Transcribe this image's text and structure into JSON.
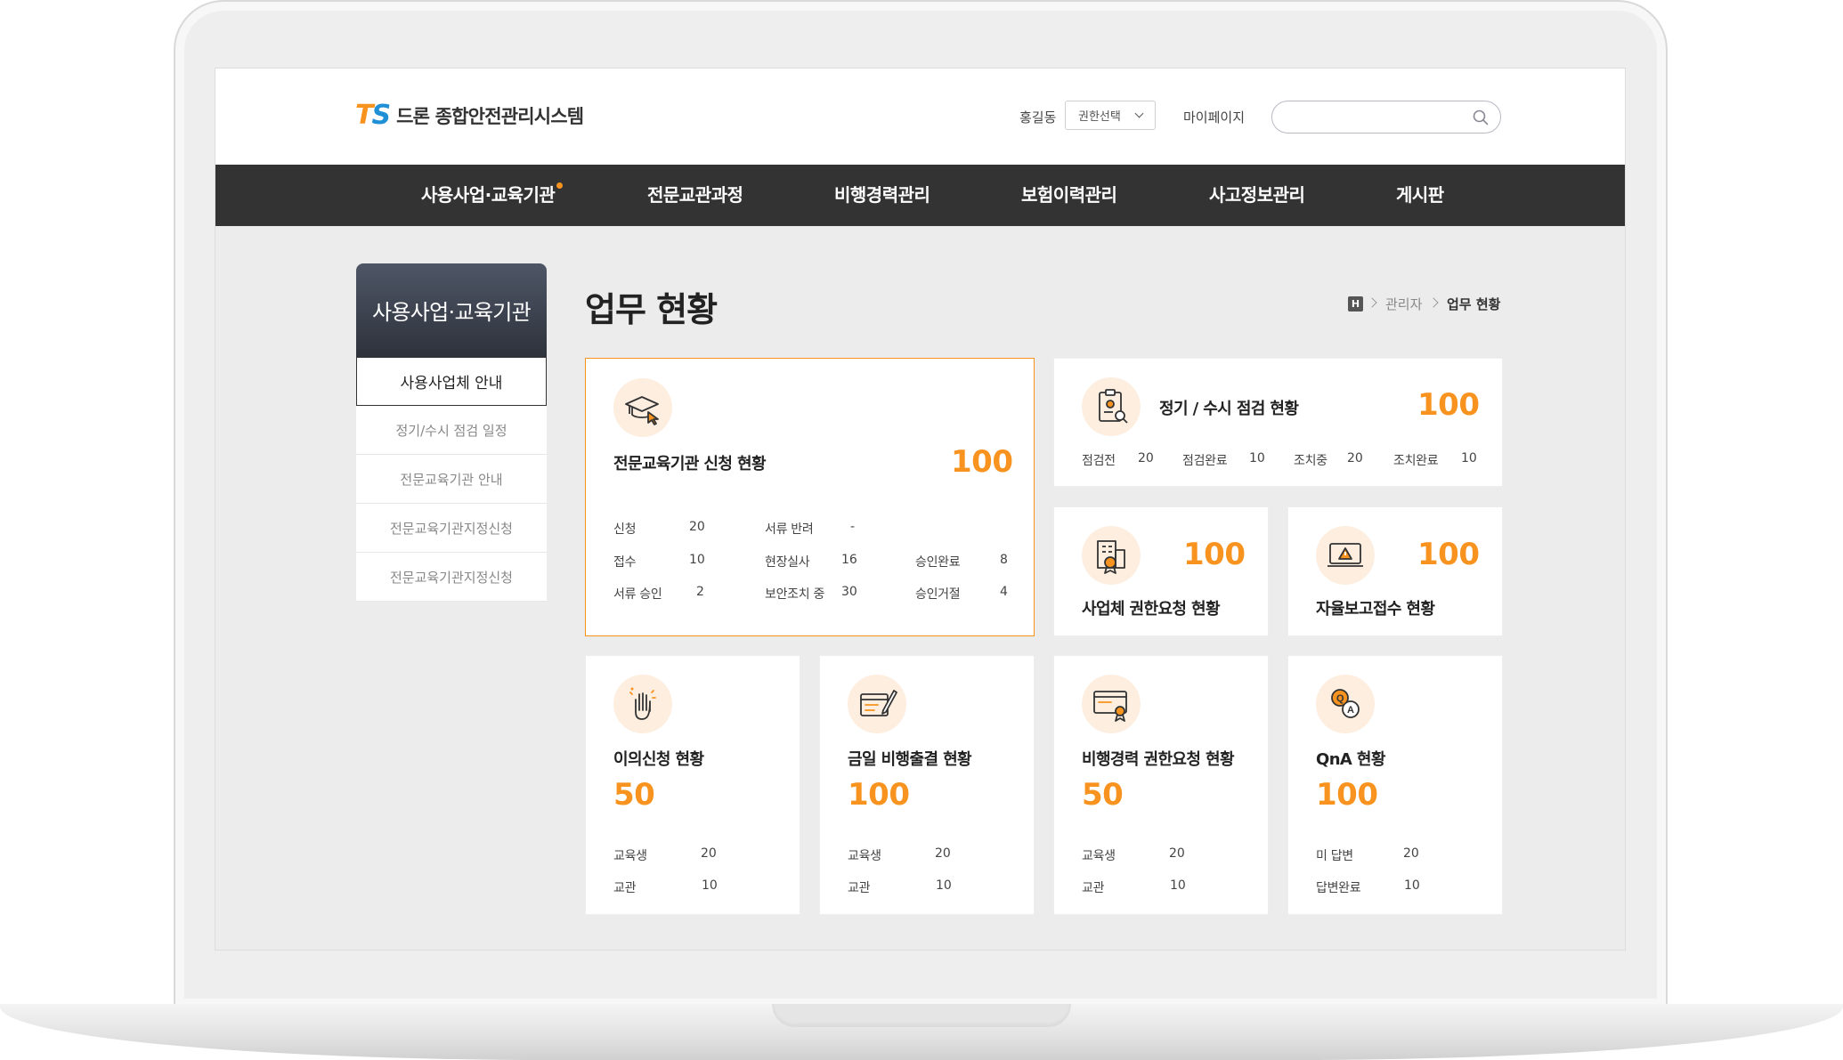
{
  "header": {
    "logo_mark_t": "T",
    "logo_mark_s": "S",
    "logo_text": "드론 종합안전관리시스템",
    "user_name": "홍길동",
    "role_select": "권한선택",
    "mypage": "마이페이지",
    "search_value": ""
  },
  "gnb": {
    "items": [
      {
        "label": "사용사업·교육기관"
      },
      {
        "label": "전문교관과정"
      },
      {
        "label": "비행경력관리"
      },
      {
        "label": "보험이력관리"
      },
      {
        "label": "사고정보관리"
      },
      {
        "label": "게시판"
      }
    ]
  },
  "lnb": {
    "title": "사용사업·교육기관",
    "items": [
      {
        "label": "사용사업체 안내"
      },
      {
        "label": "정기/수시 점검 일정"
      },
      {
        "label": "전문교육기관 안내"
      },
      {
        "label": "전문교육기관지정신청"
      },
      {
        "label": "전문교육기관지정신청"
      }
    ]
  },
  "page": {
    "title": "업무 현황",
    "breadcrumb": {
      "home": "H",
      "parent": "관리자",
      "current": "업무 현황"
    }
  },
  "cards": {
    "edu_apply": {
      "title": "전문교육기관 신청 현황",
      "count": "100",
      "stats": [
        {
          "label": "신청",
          "value": "20"
        },
        {
          "label": "서류 반려",
          "value": "-"
        },
        {
          "label": "접수",
          "value": "10"
        },
        {
          "label": "현장실사",
          "value": "16"
        },
        {
          "label": "승인완료",
          "value": "8"
        },
        {
          "label": "서류 승인",
          "value": "2"
        },
        {
          "label": "보안조치 중",
          "value": "30"
        },
        {
          "label": "승인거절",
          "value": "4"
        }
      ]
    },
    "inspection": {
      "title": "정기 / 수시 점검 현황",
      "count": "100",
      "stats": [
        {
          "label": "점검전",
          "value": "20"
        },
        {
          "label": "점검완료",
          "value": "10"
        },
        {
          "label": "조치중",
          "value": "20"
        },
        {
          "label": "조치완료",
          "value": "10"
        }
      ]
    },
    "company_auth": {
      "title": "사업체 권한요청 현황",
      "count": "100"
    },
    "self_report": {
      "title": "자율보고접수 현황",
      "count": "100"
    },
    "objection": {
      "title": "이의신청 현황",
      "count": "50",
      "stats": [
        {
          "label": "교육생",
          "value": "20"
        },
        {
          "label": "교관",
          "value": "10"
        }
      ]
    },
    "no_fly": {
      "title": "금일 비행출결 현황",
      "count": "100",
      "stats": [
        {
          "label": "교육생",
          "value": "20"
        },
        {
          "label": "교관",
          "value": "10"
        }
      ]
    },
    "flight_auth": {
      "title": "비행경력 권한요청 현황",
      "count": "50",
      "stats": [
        {
          "label": "교육생",
          "value": "20"
        },
        {
          "label": "교관",
          "value": "10"
        }
      ]
    },
    "qna": {
      "title": "QnA 현황",
      "count": "100",
      "stats": [
        {
          "label": "미 답변",
          "value": "20"
        },
        {
          "label": "답변완료",
          "value": "10"
        }
      ]
    }
  },
  "colors": {
    "accent": "#f7931e",
    "nav_bg": "#333333",
    "icon_bg": "#fdeee0",
    "logo_blue": "#1f8fd6"
  },
  "icons": {
    "edu_apply": "graduation-cap-cursor-icon",
    "inspection": "clipboard-magnifier-icon",
    "company_auth": "building-badge-icon",
    "self_report": "monitor-warning-icon",
    "objection": "raised-hand-icon",
    "no_fly": "window-pen-icon",
    "flight_auth": "certificate-ribbon-icon",
    "qna": "qa-bubbles-icon"
  }
}
